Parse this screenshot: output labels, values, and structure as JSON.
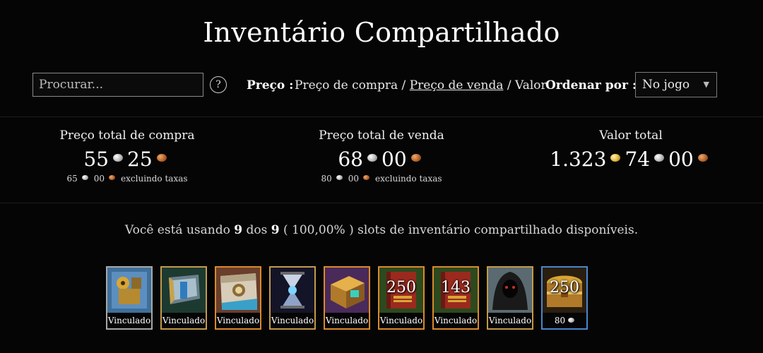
{
  "page": {
    "title": "Inventário Compartilhado"
  },
  "toolbar": {
    "search_placeholder": "Procurar...",
    "help_label": "?",
    "price_label": "Preço :",
    "price_options": [
      "Preço de compra",
      "Preço de venda",
      "Valor"
    ],
    "price_separator": " / ",
    "active_price_option": "Preço de venda",
    "sort_label": "Ordenar por :",
    "sort_value": "No jogo",
    "sort_arrow": "▼"
  },
  "stats": {
    "buy": {
      "label": "Preço total de compra",
      "silver": "55",
      "copper": "25",
      "net_silver": "65",
      "net_copper": "00",
      "net_note": "excluindo taxas"
    },
    "sell": {
      "label": "Preço total de venda",
      "silver": "68",
      "copper": "00",
      "net_silver": "80",
      "net_copper": "00",
      "net_note": "excluindo taxas"
    },
    "value": {
      "label": "Valor total",
      "gold": "1.323",
      "silver": "74",
      "copper": "00"
    }
  },
  "usage": {
    "prefix": "Você está usando",
    "used": "9",
    "middle": "dos",
    "total": "9",
    "percent": "( 100,00% )",
    "suffix": "slots de inventário compartilhado disponíveis."
  },
  "slots": [
    {
      "caption": "Vinculado",
      "count": "",
      "rarity": "basic",
      "icon": "golem-kit-icon"
    },
    {
      "caption": "Vinculado",
      "count": "",
      "rarity": "fine",
      "icon": "shield-box-icon"
    },
    {
      "caption": "Vinculado",
      "count": "",
      "rarity": "rare",
      "icon": "scroll-pass-icon"
    },
    {
      "caption": "Vinculado",
      "count": "",
      "rarity": "fine",
      "icon": "hourglass-icon"
    },
    {
      "caption": "Vinculado",
      "count": "",
      "rarity": "rare",
      "icon": "treasure-chest-icon"
    },
    {
      "caption": "Vinculado",
      "count": "250",
      "rarity": "rare",
      "icon": "red-tome-icon"
    },
    {
      "caption": "Vinculado",
      "count": "143",
      "rarity": "rare",
      "icon": "red-tome-icon"
    },
    {
      "caption": "Vinculado",
      "count": "",
      "rarity": "fine",
      "icon": "hooded-figure-icon"
    },
    {
      "caption": "80",
      "count": "250",
      "rarity": "blue",
      "icon": "gold-chest-icon",
      "caption_coin": "silver"
    }
  ],
  "colors": {
    "background": "#050505",
    "text": "#e8e8e8",
    "fine_border": "#c29a4a",
    "rare_border": "#d98a2c",
    "blue_border": "#4a86c8",
    "basic_border": "#a8a8a8"
  }
}
